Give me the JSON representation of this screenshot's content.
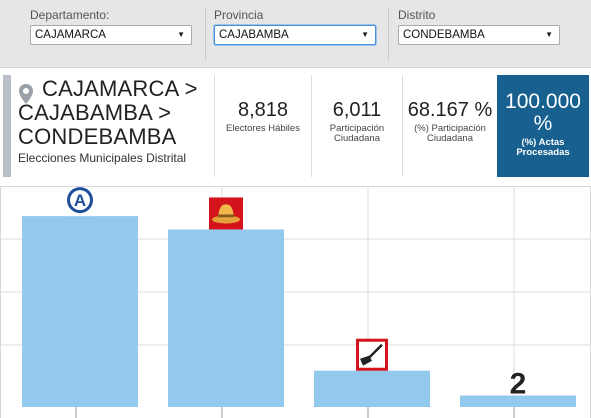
{
  "filters": {
    "departamento": {
      "label": "Departamento:",
      "value": "CAJAMARCA"
    },
    "provincia": {
      "label": "Provincia",
      "value": "CAJABAMBA"
    },
    "distrito": {
      "label": "Distrito",
      "value": "CONDEBAMBA"
    }
  },
  "header": {
    "title_line1": "CAJAMARCA >",
    "title_line2": "CAJABAMBA >",
    "title_line3": "CONDEBAMBA",
    "subtitle": "Elecciones Municipales Distrital",
    "stats": [
      {
        "value": "8,818",
        "label": "Electores Hábiles"
      },
      {
        "value": "6,011",
        "label": "Participación Ciudadana"
      },
      {
        "value": "68.167 %",
        "label": "(%) Participación Ciudadana"
      },
      {
        "value": "100.000 %",
        "label": "(%) Actas Procesadas"
      }
    ],
    "accent_color": "#17608f"
  },
  "chart_data": {
    "type": "bar",
    "categories": [
      "A",
      "sombrero",
      "pala",
      "2"
    ],
    "values": [
      100,
      93,
      19,
      6
    ],
    "ylim": [
      0,
      110
    ],
    "grid": true,
    "bar_color": "#93c9ec",
    "icons": [
      "letter-a-logo",
      "hat-logo",
      "shovel-logo",
      "number-2-logo"
    ]
  }
}
